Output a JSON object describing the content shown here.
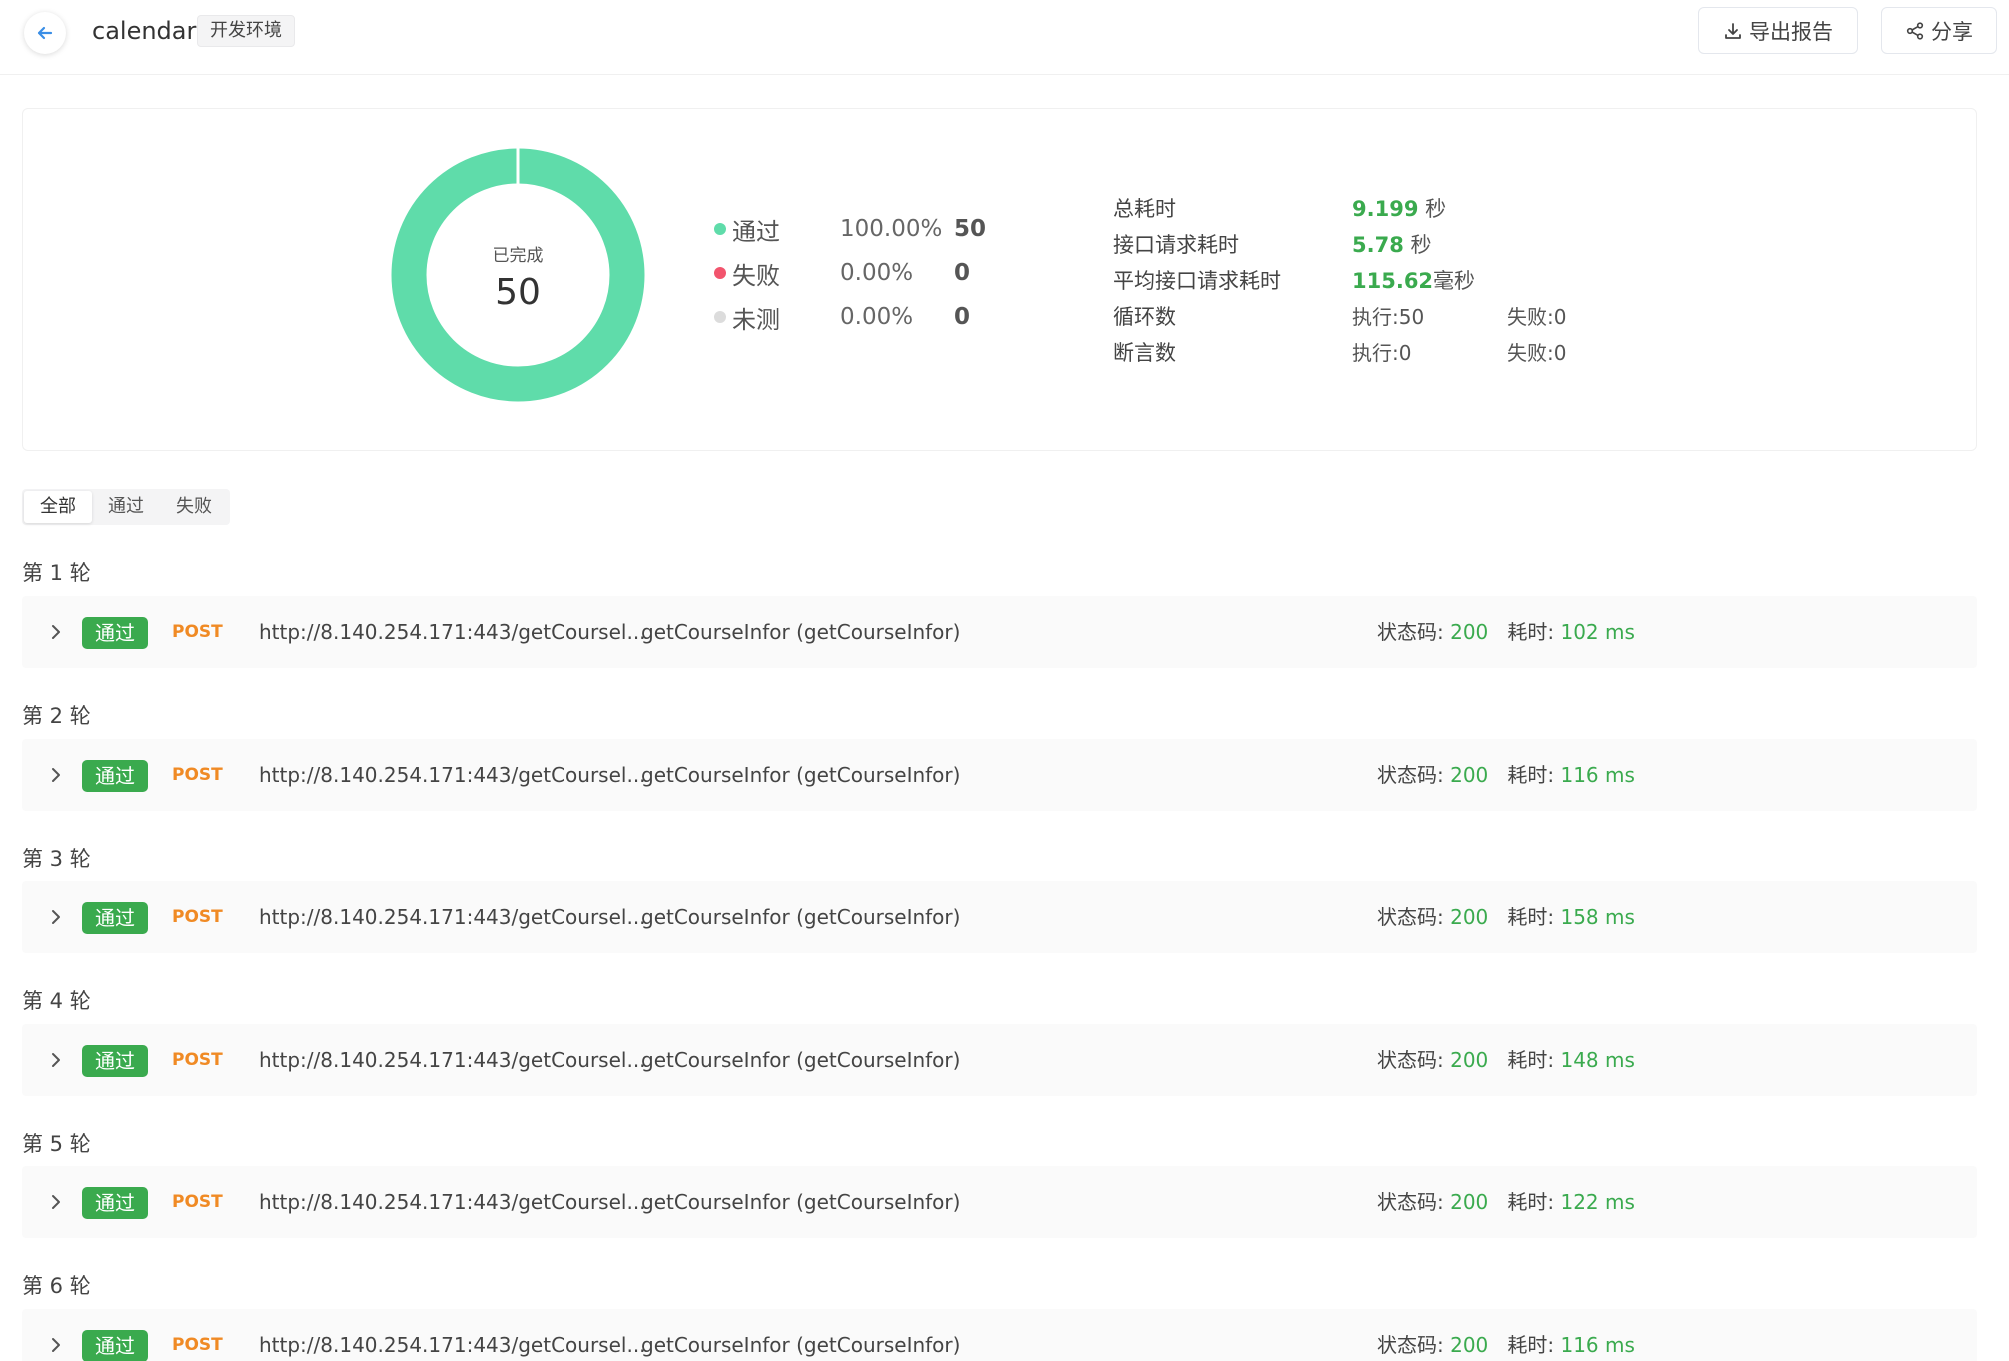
{
  "header": {
    "title": "calendar",
    "env": "开发环境",
    "export_label": "导出报告",
    "share_label": "分享"
  },
  "summary": {
    "donut_label": "已完成",
    "donut_total": "50",
    "legend": [
      {
        "name": "通过",
        "percent": "100.00%",
        "count": "50",
        "color": "#5fdcaa"
      },
      {
        "name": "失败",
        "percent": "0.00%",
        "count": "0",
        "color": "#f2546d"
      },
      {
        "name": "未测",
        "percent": "0.00%",
        "count": "0",
        "color": "#dcdcdc"
      }
    ],
    "stats": {
      "total_time_label": "总耗时",
      "total_time_value": "9.199",
      "total_time_unit": " 秒",
      "req_time_label": "接口请求耗时",
      "req_time_value": "5.78",
      "req_time_unit": " 秒",
      "avg_time_label": "平均接口请求耗时",
      "avg_time_value": "115.62",
      "avg_time_unit": "毫秒",
      "loop_label": "循环数",
      "loop_exec": "执行:50",
      "loop_fail": "失败:0",
      "assert_label": "断言数",
      "assert_exec": "执行:0",
      "assert_fail": "失败:0"
    }
  },
  "filters": [
    "全部",
    "通过",
    "失败"
  ],
  "rounds": [
    {
      "label": "第 1 轮",
      "status": "通过",
      "method": "POST",
      "url": "http://8.140.254.171:443/getCoursel...",
      "api": "getCourseInfor (getCourseInfor)",
      "code_label": "状态码: ",
      "code": "200",
      "time_label": "耗时: ",
      "time": "102 ms"
    },
    {
      "label": "第 2 轮",
      "status": "通过",
      "method": "POST",
      "url": "http://8.140.254.171:443/getCoursel...",
      "api": "getCourseInfor (getCourseInfor)",
      "code_label": "状态码: ",
      "code": "200",
      "time_label": "耗时: ",
      "time": "116 ms"
    },
    {
      "label": "第 3 轮",
      "status": "通过",
      "method": "POST",
      "url": "http://8.140.254.171:443/getCoursel...",
      "api": "getCourseInfor (getCourseInfor)",
      "code_label": "状态码: ",
      "code": "200",
      "time_label": "耗时: ",
      "time": "158 ms"
    },
    {
      "label": "第 4 轮",
      "status": "通过",
      "method": "POST",
      "url": "http://8.140.254.171:443/getCoursel...",
      "api": "getCourseInfor (getCourseInfor)",
      "code_label": "状态码: ",
      "code": "200",
      "time_label": "耗时: ",
      "time": "148 ms"
    },
    {
      "label": "第 5 轮",
      "status": "通过",
      "method": "POST",
      "url": "http://8.140.254.171:443/getCoursel...",
      "api": "getCourseInfor (getCourseInfor)",
      "code_label": "状态码: ",
      "code": "200",
      "time_label": "耗时: ",
      "time": "122 ms"
    },
    {
      "label": "第 6 轮",
      "status": "通过",
      "method": "POST",
      "url": "http://8.140.254.171:443/getCoursel...",
      "api": "getCourseInfor (getCourseInfor)",
      "code_label": "状态码: ",
      "code": "200",
      "time_label": "耗时: ",
      "time": "116 ms"
    }
  ],
  "colors": {
    "pass": "#3aaa4e",
    "donut": "#5fdcaa",
    "method": "#f08a24"
  }
}
